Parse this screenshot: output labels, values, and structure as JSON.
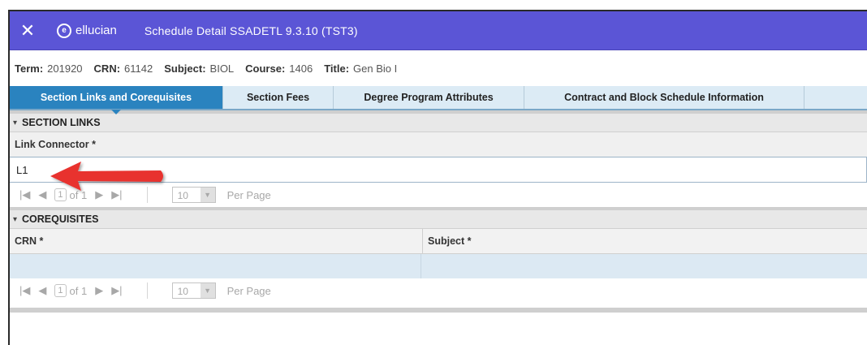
{
  "header": {
    "close_glyph": "✕",
    "logo_text": "ellucian",
    "app_title": "Schedule Detail SSADETL 9.3.10 (TST3)",
    "bg_color": "#5b55d6"
  },
  "keyblock": {
    "term_label": "Term:",
    "term_value": "201920",
    "crn_label": "CRN:",
    "crn_value": "61142",
    "subject_label": "Subject:",
    "subject_value": "BIOL",
    "course_label": "Course:",
    "course_value": "1406",
    "title_label": "Title:",
    "title_value": "Gen Bio I"
  },
  "tabs": [
    {
      "label": "Section Links and Corequisites",
      "active": true
    },
    {
      "label": "Section Fees",
      "active": false
    },
    {
      "label": "Degree Program Attributes",
      "active": false
    },
    {
      "label": "Contract and Block Schedule Information",
      "active": false
    }
  ],
  "section_links": {
    "heading": "SECTION LINKS",
    "field_label": "Link Connector *",
    "field_value": "L1",
    "pager": {
      "page": "1",
      "of_text": "of 1",
      "per_page_value": "10",
      "per_page_label": "Per Page"
    }
  },
  "corequisites": {
    "heading": "COREQUISITES",
    "columns": [
      "CRN *",
      "Subject *"
    ],
    "pager": {
      "page": "1",
      "of_text": "of 1",
      "per_page_value": "10",
      "per_page_label": "Per Page"
    }
  },
  "annotation": {
    "arrow_color": "#e8322f"
  },
  "icons": {
    "first": "first-page-icon",
    "prev": "previous-page-icon",
    "next": "next-page-icon",
    "last": "last-page-icon",
    "collapse": "collapse-triangle-icon",
    "dropdown": "dropdown-arrow-icon"
  }
}
